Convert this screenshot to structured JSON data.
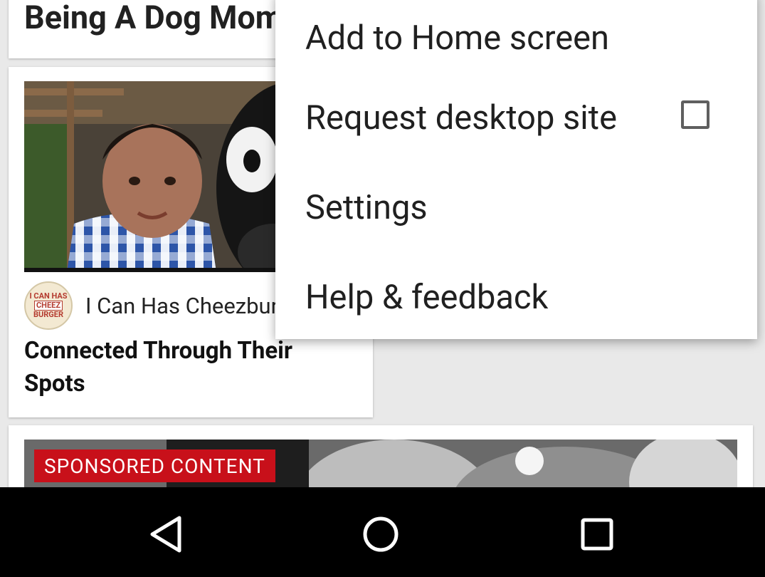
{
  "feed": {
    "top_card_title": "Being A Dog Mom",
    "main_card": {
      "source_logo_lines": [
        "I CAN HAS",
        "CHEEZ",
        "BURGER"
      ],
      "source_name": "I Can Has Cheezburger",
      "headline": "Connected Through Their Spots"
    },
    "sponsored_card": {
      "badge": "SPONSORED CONTENT"
    }
  },
  "menu": {
    "items": [
      {
        "label": "Add to Home screen"
      },
      {
        "label": "Request desktop site",
        "checked": false
      },
      {
        "label": "Settings"
      },
      {
        "label": "Help & feedback"
      }
    ]
  },
  "navbar": {
    "back_icon": "back-triangle-icon",
    "home_icon": "home-circle-icon",
    "recents_icon": "recents-square-icon"
  },
  "colors": {
    "sponsored_badge": "#c8101a",
    "navbar_bg": "#000000",
    "menu_bg": "#ffffff"
  }
}
